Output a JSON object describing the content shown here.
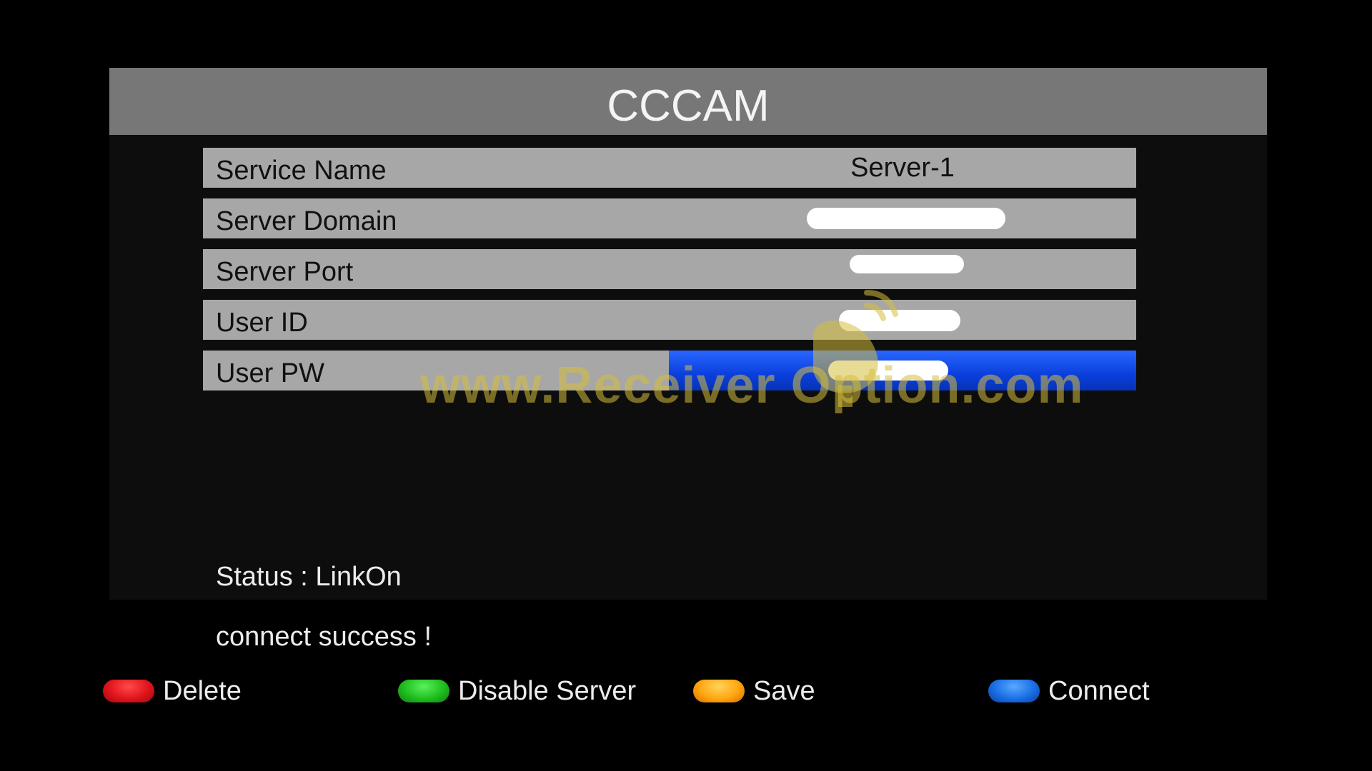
{
  "title": "CCCAM",
  "fields": [
    {
      "label": "Service Name",
      "value": "Server-1"
    },
    {
      "label": "Server Domain",
      "value": ""
    },
    {
      "label": "Server Port",
      "value": ""
    },
    {
      "label": "User ID",
      "value": ""
    },
    {
      "label": "User PW",
      "value": ""
    }
  ],
  "selected_field": "User PW",
  "status": "Status : LinkOn",
  "message": "connect success !",
  "watermark": "www.Receiver Option.com",
  "hints": [
    {
      "label": "Delete",
      "color": "#e0141c"
    },
    {
      "label": "Disable Server",
      "color": "#1fbf1f"
    },
    {
      "label": "Save",
      "color": "#ffa60f"
    },
    {
      "label": "Connect",
      "color": "#1a6fe6"
    }
  ],
  "colors": {
    "title_bar": "#777777",
    "row_background": "#a7a7a7",
    "selected_value": "#0a3fdc",
    "panel_background": "#0d0d0d"
  }
}
